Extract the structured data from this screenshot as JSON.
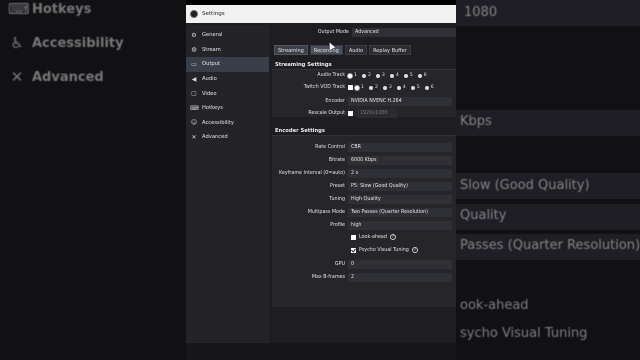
{
  "background": {
    "left_items": [
      {
        "label": "Hotkeys",
        "icon": "keyboard-icon"
      },
      {
        "label": "Accessibility",
        "icon": "accessibility-icon"
      },
      {
        "label": "Advanced",
        "icon": "wrench-icon"
      }
    ],
    "right_texts": [
      "1080",
      "Kbps",
      "Slow (Good Quality)",
      "Quality",
      "Passes (Quarter Resolution)",
      "ook-ahead",
      "sycho Visual Tuning"
    ]
  },
  "window": {
    "title": "Settings",
    "sidebar": [
      {
        "label": "General",
        "icon": "gear-icon",
        "active": false
      },
      {
        "label": "Stream",
        "icon": "globe-icon",
        "active": false
      },
      {
        "label": "Output",
        "icon": "output-icon",
        "active": true
      },
      {
        "label": "Audio",
        "icon": "speaker-icon",
        "active": false
      },
      {
        "label": "Video",
        "icon": "monitor-icon",
        "active": false
      },
      {
        "label": "Hotkeys",
        "icon": "keyboard-icon",
        "active": false
      },
      {
        "label": "Accessibility",
        "icon": "accessibility-icon",
        "active": false
      },
      {
        "label": "Advanced",
        "icon": "wrench-icon",
        "active": false
      }
    ],
    "output_mode": {
      "label": "Output Mode",
      "value": "Advanced"
    },
    "tabs": [
      "Streaming",
      "Recording",
      "Audio",
      "Replay Buffer"
    ],
    "active_tab": "Streaming",
    "hover_tab": "Recording",
    "streaming_settings": {
      "title": "Streaming Settings",
      "audio_track_label": "Audio Track",
      "audio_tracks": [
        "1",
        "2",
        "3",
        "4",
        "5",
        "6"
      ],
      "twitch_vod_label": "Twitch VOD Track",
      "encoder_label": "Encoder",
      "encoder_value": "NVIDIA NVENC H.264",
      "rescale_label": "Rescale Output",
      "rescale_value": "1920x1080"
    },
    "encoder_settings": {
      "title": "Encoder Settings",
      "rate_control": {
        "label": "Rate Control",
        "value": "CBR"
      },
      "bitrate": {
        "label": "Bitrate",
        "value": "6000 Kbps"
      },
      "keyframe": {
        "label": "Keyframe Interval (0=auto)",
        "value": "2 s"
      },
      "preset": {
        "label": "Preset",
        "value": "P5: Slow (Good Quality)"
      },
      "tuning": {
        "label": "Tuning",
        "value": "High Quality"
      },
      "multipass": {
        "label": "Multipass Mode",
        "value": "Two Passes (Quarter Resolution)"
      },
      "profile": {
        "label": "Profile",
        "value": "high"
      },
      "lookahead_label": "Look-ahead",
      "psycho_label": "Psycho Visual Tuning",
      "gpu": {
        "label": "GPU",
        "value": "0"
      },
      "bframes": {
        "label": "Max B-frames",
        "value": "2"
      }
    }
  }
}
